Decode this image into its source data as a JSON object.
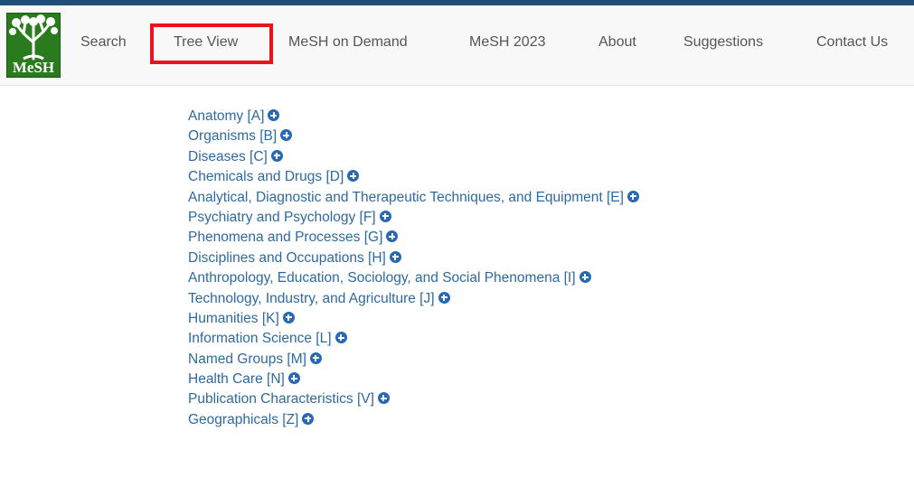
{
  "logo": {
    "text": "MeSH"
  },
  "nav": {
    "search": "Search",
    "tree_view": "Tree View",
    "mesh_on_demand": "MeSH on Demand",
    "mesh_2023": "MeSH 2023",
    "about": "About",
    "suggestions": "Suggestions",
    "contact_us": "Contact Us"
  },
  "tree": [
    "Anatomy [A]",
    "Organisms [B]",
    "Diseases [C]",
    "Chemicals and Drugs [D]",
    "Analytical, Diagnostic and Therapeutic Techniques, and Equipment [E]",
    "Psychiatry and Psychology [F]",
    "Phenomena and Processes [G]",
    "Disciplines and Occupations [H]",
    "Anthropology, Education, Sociology, and Social Phenomena [I]",
    "Technology, Industry, and Agriculture [J]",
    "Humanities [K]",
    "Information Science [L]",
    "Named Groups [M]",
    "Health Care [N]",
    "Publication Characteristics [V]",
    "Geographicals [Z]"
  ],
  "colors": {
    "link": "#2d6aa0",
    "expand_icon": "#2769b3",
    "highlight_box": "#e8141b",
    "logo_green": "#2a7a1e"
  }
}
